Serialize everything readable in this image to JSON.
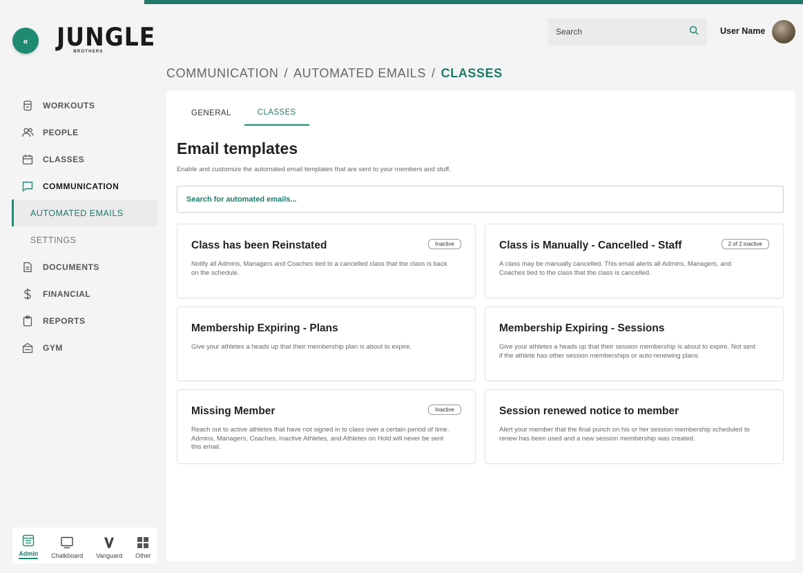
{
  "app": {
    "logo_main": "JUNGLE",
    "logo_sub": "BROTHERS",
    "collapse_glyph": "«",
    "accent_color": "#1f8a72"
  },
  "header": {
    "search_placeholder": "Search",
    "user_name": "User Name"
  },
  "breadcrumb": {
    "items": [
      "COMMUNICATION",
      "AUTOMATED EMAILS"
    ],
    "current": "CLASSES",
    "separator": "/"
  },
  "sidebar": {
    "items": [
      {
        "label": "WORKOUTS",
        "icon": "workouts-icon"
      },
      {
        "label": "PEOPLE",
        "icon": "people-icon"
      },
      {
        "label": "CLASSES",
        "icon": "calendar-icon"
      },
      {
        "label": "COMMUNICATION",
        "icon": "chat-icon"
      },
      {
        "label": "DOCUMENTS",
        "icon": "document-icon"
      },
      {
        "label": "FINANCIAL",
        "icon": "dollar-icon"
      },
      {
        "label": "REPORTS",
        "icon": "clipboard-icon"
      },
      {
        "label": "GYM",
        "icon": "gym-icon"
      }
    ],
    "subitems": [
      {
        "label": "AUTOMATED EMAILS"
      },
      {
        "label": "SETTINGS"
      }
    ],
    "switcher": [
      {
        "label": "Admin",
        "icon": "admin-icon"
      },
      {
        "label": "Chalkboard",
        "icon": "monitor-icon"
      },
      {
        "label": "Vanguard",
        "icon": "vanguard-icon"
      },
      {
        "label": "Other",
        "icon": "grid-icon"
      }
    ]
  },
  "main": {
    "tabs": [
      {
        "label": "GENERAL"
      },
      {
        "label": "CLASSES"
      }
    ],
    "title": "Email templates",
    "subtitle": "Enable and customize the automated email templates that are sent to your members and stuff.",
    "search_placeholder": "Search for automated emails...",
    "cards": [
      {
        "title": "Class has been Reinstated",
        "badge": "Inactive",
        "description": "Notify all Admins, Managers and Coaches tied to a cancelled class that the class is back on the schedule."
      },
      {
        "title": "Class is Manually - Cancelled - Staff",
        "badge": "2 of 2 inactive",
        "description": "A class may be manually cancelled. This email alerts all Admins, Managers, and Coaches tied to the class that the class is cancelled."
      },
      {
        "title": "Membership Expiring - Plans",
        "badge": "",
        "description": "Give your athletes a heads up that their membership plan is about to expire."
      },
      {
        "title": "Membership Expiring - Sessions",
        "badge": "",
        "description": "Give your athletes a heads up that their session membership is about to expire. Not sent if the athlete has other session memberships or auto-renewing plans."
      },
      {
        "title": "Missing Member",
        "badge": "Inactive",
        "description": "Reach out to active athletes that have not signed in to class over a certain period of time. Admins, Managers, Coaches, Inactive Athletes, and Athletes on Hold will never be sent this email."
      },
      {
        "title": "Session renewed notice to member",
        "badge": "",
        "description": "Alert your member that the final punch on his or her session membership scheduled to renew has been used and a new session membership was created."
      }
    ]
  }
}
